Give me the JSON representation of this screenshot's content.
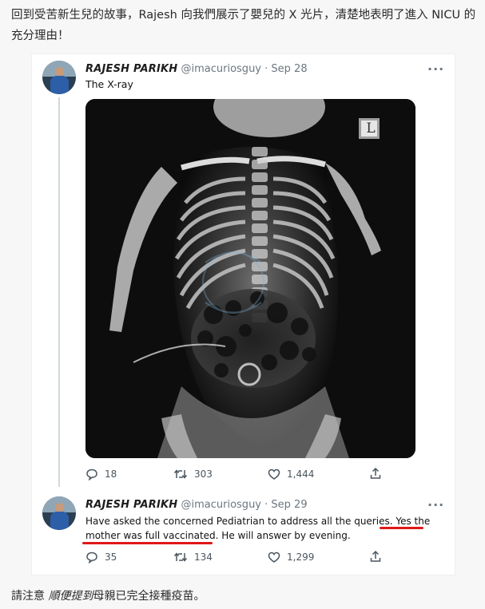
{
  "intro": {
    "text": "回到受苦新生兒的故事，Rajesh 向我們展示了嬰兒的 X 光片，清楚地表明了進入 NICU 的充分理由！"
  },
  "tweet1": {
    "name": "RAJESH PARIKH",
    "handle": "@imacuriosguy",
    "separator": "·",
    "date": "Sep 28",
    "text": "The X-ray",
    "xray_marker": "L",
    "replies": "18",
    "retweets": "303",
    "likes": "1,444"
  },
  "tweet2": {
    "name": "RAJESH PARIKH",
    "handle": "@imacuriosguy",
    "separator": "·",
    "date": "Sep 29",
    "text_line1": "Have asked the concerned Pediatrian to address all the queries. Yes the",
    "text_line2": "mother was full vaccinated. He will answer by evening.",
    "replies": "35",
    "retweets": "134",
    "likes": "1,299"
  },
  "footer": {
    "prefix": "請注意 ",
    "emphasis": "順便提到",
    "suffix": "母親已完全接種疫苗。"
  },
  "colors": {
    "underline": "#e01818",
    "meta": "#6b7680",
    "thread_line": "#cfd9de"
  },
  "icons": [
    "reply-icon",
    "retweet-icon",
    "like-icon",
    "share-icon",
    "more-icon"
  ]
}
